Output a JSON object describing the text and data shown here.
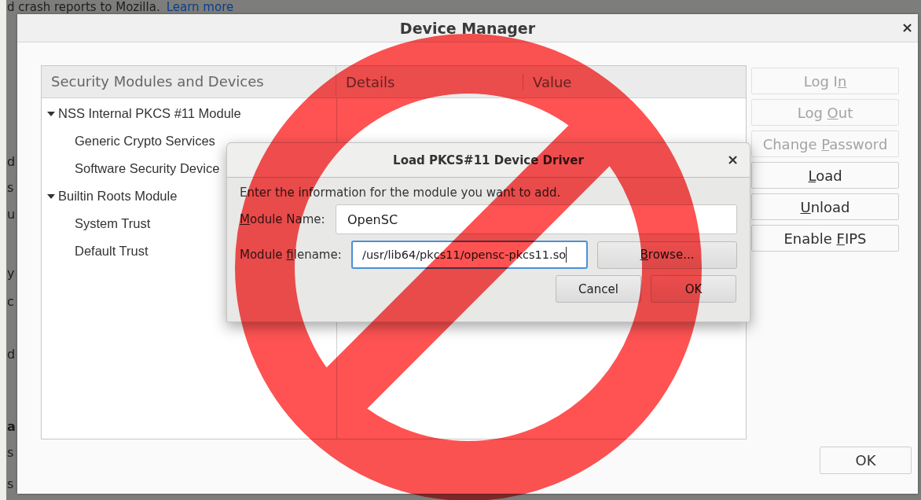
{
  "background_page": {
    "text": "d crash reports to Mozilla.",
    "link": "Learn more",
    "fragments": [
      {
        "text": "d",
        "bold": false
      },
      {
        "text": "s",
        "bold": false
      },
      {
        "text": "u",
        "bold": false
      },
      {
        "text": "y",
        "bold": false
      },
      {
        "text": "c",
        "bold": false
      },
      {
        "text": "d",
        "bold": false
      },
      {
        "text": "a",
        "bold": true
      },
      {
        "text": "s",
        "bold": false
      },
      {
        "text": "s",
        "bold": false
      }
    ]
  },
  "window": {
    "title": "Device Manager",
    "close": "×"
  },
  "tree": {
    "columns": [
      "Security Modules and Devices",
      "Details",
      "Value"
    ],
    "items": [
      {
        "label": "NSS Internal PKCS #11 Module",
        "expanded": true,
        "children": [
          {
            "label": "Generic Crypto Services"
          },
          {
            "label": "Software Security Device"
          }
        ]
      },
      {
        "label": "Builtin Roots Module",
        "expanded": true,
        "children": [
          {
            "label": "System Trust"
          },
          {
            "label": "Default Trust"
          }
        ]
      }
    ]
  },
  "side_buttons": [
    {
      "pre": "Log I",
      "key": "n",
      "disabled": true
    },
    {
      "pre": "Log ",
      "key": "O",
      "post": "ut",
      "disabled": true
    },
    {
      "pre": "Change ",
      "key": "P",
      "post": "assword",
      "disabled": true
    },
    {
      "key": "L",
      "post": "oad",
      "disabled": false
    },
    {
      "key": "U",
      "post": "nload",
      "disabled": false
    },
    {
      "pre": "Enable ",
      "key": "F",
      "post": "IPS",
      "disabled": false
    }
  ],
  "ok_button": "OK",
  "dialog": {
    "title": "Load PKCS#11 Device Driver",
    "close": "×",
    "intro": "Enter the information for the module you want to add.",
    "fields": [
      {
        "label": {
          "key": "M",
          "post": "odule Name:"
        },
        "value": "OpenSC",
        "focused": false
      },
      {
        "label": {
          "pre": "Module ",
          "key": "f",
          "post": "ilename:"
        },
        "value": "/usr/lib64/pkcs11/opensc-pkcs11.so",
        "focused": true,
        "button": {
          "key": "B",
          "post": "rowse..."
        }
      }
    ],
    "buttons": [
      "Cancel",
      "OK"
    ]
  },
  "overlay": {
    "kind": "prohibition-sign"
  }
}
